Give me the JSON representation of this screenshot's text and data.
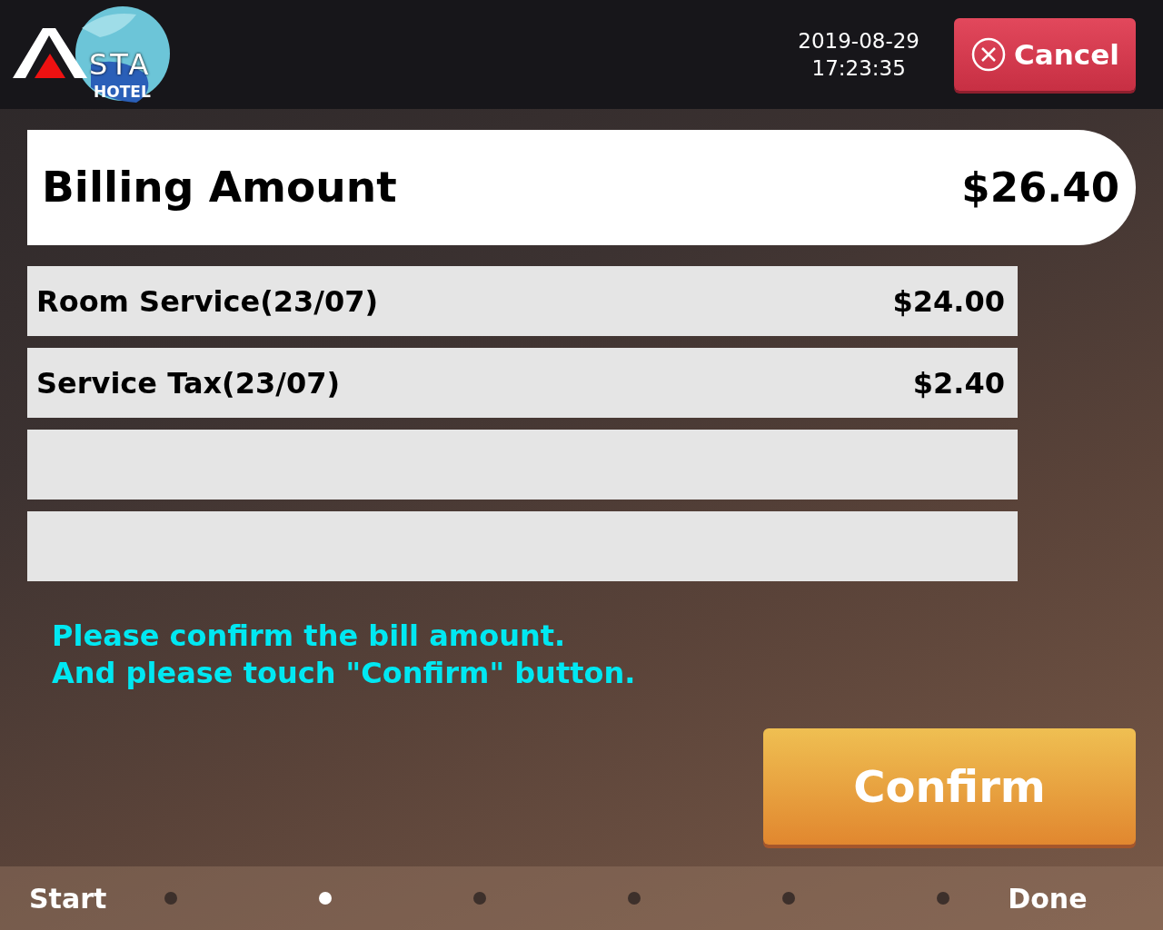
{
  "header": {
    "logo": {
      "text": "STA",
      "subtext": "HOTEL"
    },
    "date": "2019-08-29",
    "time": "17:23:35",
    "cancel_button": "Cancel"
  },
  "billing": {
    "label": "Billing Amount",
    "amount": "$26.40"
  },
  "line_items": [
    {
      "kind": "charge",
      "description": "Room Service(23/07)",
      "amount": "$24.00"
    },
    {
      "kind": "charge",
      "description": "Service Tax(23/07)",
      "amount": "$2.40"
    },
    {
      "kind": "blank"
    },
    {
      "kind": "blank"
    }
  ],
  "message": [
    "Please confirm the bill amount.",
    "And please touch \"Confirm\" button."
  ],
  "confirm_button": "Confirm",
  "progress": {
    "start_label": "Start",
    "end_label": "Done",
    "steps": [
      {
        "selected": false
      },
      {
        "selected": true
      },
      {
        "selected": false
      },
      {
        "selected": false
      },
      {
        "selected": false
      },
      {
        "selected": false
      }
    ]
  }
}
